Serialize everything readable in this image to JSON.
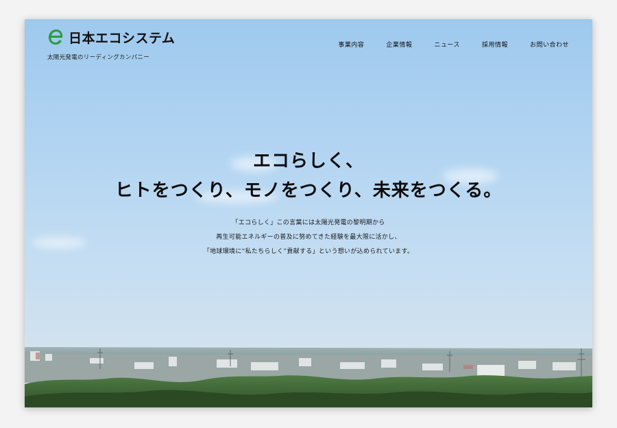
{
  "header": {
    "logo_text": "日本エコシステム",
    "tagline": "太陽光発電のリーディングカンパニー",
    "nav": [
      {
        "label": "事業内容"
      },
      {
        "label": "企業情報"
      },
      {
        "label": "ニュース"
      },
      {
        "label": "採用情報"
      },
      {
        "label": "お問い合わせ"
      }
    ]
  },
  "hero": {
    "line1": "エコらしく、",
    "line2": "ヒトをつくり、モノをつくり、未来をつくる。"
  },
  "description": {
    "lines": [
      "「エコらしく」この言葉には太陽光発電の黎明期から",
      "再生可能エネルギーの普及に努めてきた経験を最大限に活かし、",
      "「地球環境に“私たちらしく”貢献する」という想いが込められています。"
    ]
  },
  "colors": {
    "logo_green": "#2e9a3c",
    "sky_top": "#9ec9ee",
    "sky_bottom": "#d9e4ea",
    "text": "#111111"
  },
  "icons": {
    "logo": "eco-e-logo-icon"
  }
}
